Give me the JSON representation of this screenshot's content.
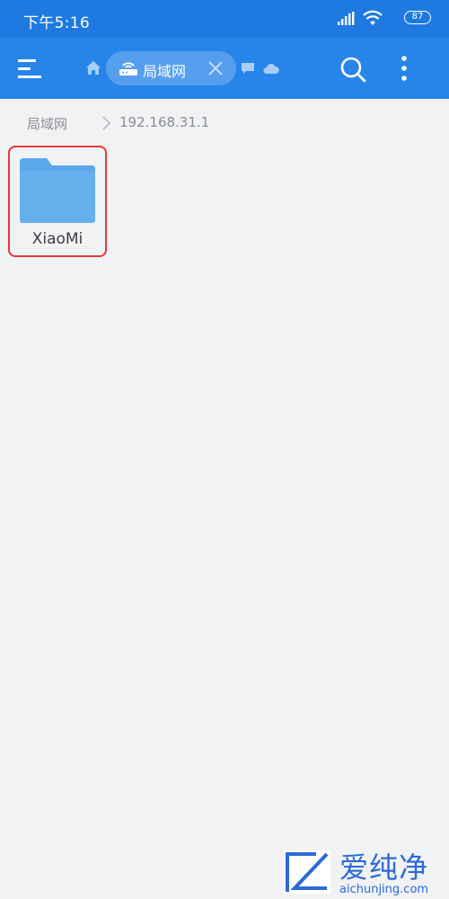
{
  "status_bar": {
    "time": "下午5:16",
    "battery": "87",
    "icons": [
      "signal-icon",
      "wifi-icon",
      "battery-icon"
    ]
  },
  "app_bar": {
    "menu_icon": "menu-icon",
    "home_icon": "home-icon",
    "active_tab": {
      "icon": "router-icon",
      "label": "局域网",
      "close_icon": "close-icon"
    },
    "other_tab_icons": [
      "chat-icon",
      "cloud-icon"
    ],
    "search_icon": "search-icon",
    "more_icon": "more-vertical-icon"
  },
  "breadcrumb": {
    "items": [
      "局域网",
      "192.168.31.1"
    ]
  },
  "files": [
    {
      "name": "XiaoMi",
      "type": "folder",
      "highlighted": true
    }
  ],
  "watermark": {
    "brand": "爱纯净",
    "url": "aichunjing.com"
  },
  "colors": {
    "status_bar": "#1e7ae1",
    "app_bar": "#2785ea",
    "background": "#f1f2f4",
    "folder": "#5aa7ea",
    "highlight": "#e53a3a",
    "watermark": "#2d6ad6"
  }
}
